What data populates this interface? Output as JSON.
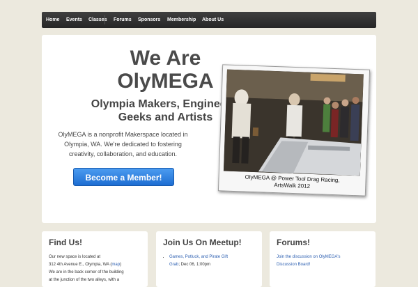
{
  "nav": {
    "items": [
      {
        "label": "Home"
      },
      {
        "label": "Events"
      },
      {
        "label": "Classes"
      },
      {
        "label": "Forums"
      },
      {
        "label": "Sponsors"
      },
      {
        "label": "Membership"
      },
      {
        "label": "About Us"
      }
    ]
  },
  "hero": {
    "title_line1": "We Are",
    "title_line2": "OlyMEGA",
    "subtitle_line1": "Olympia Makers, Engineers,",
    "subtitle_line2": "Geeks and Artists",
    "description_line1": "OlyMEGA is a nonprofit Makerspace located in",
    "description_line2": "Olympia, WA. We're dedicated to fostering",
    "description_line3": "creativity, collaboration, and education.",
    "cta_label": "Become a Member!",
    "photo_caption_line1": "OlyMEGA @ Power Tool Drag Racing,",
    "photo_caption_line2": "ArtsWalk 2012"
  },
  "cards": {
    "find": {
      "title": "Find Us!",
      "line1": "Our new space is located at",
      "line2_text": "312 4th Avenue E., Olympia, WA (",
      "map_link": "map",
      "line2_end": ")",
      "line3": "We are in the back corner of the building",
      "line4": "at the junction of the two alleys, with a"
    },
    "meetup": {
      "title": "Join Us On Meetup!",
      "event_link_line1": "Games, Potluck, and Pirate Gift",
      "event_link_line2": "Grab",
      "event_date": "; Dec 06, 1:00pm"
    },
    "forums": {
      "title": "Forums!",
      "link_line1": "Join the discussion on OlyMEGA's",
      "link_line2": "Discussion Board!"
    }
  },
  "colors": {
    "page_bg": "#ece9de",
    "nav_bg": "#2f2f2f",
    "button": "#2a7de0",
    "link": "#2a5db0"
  }
}
